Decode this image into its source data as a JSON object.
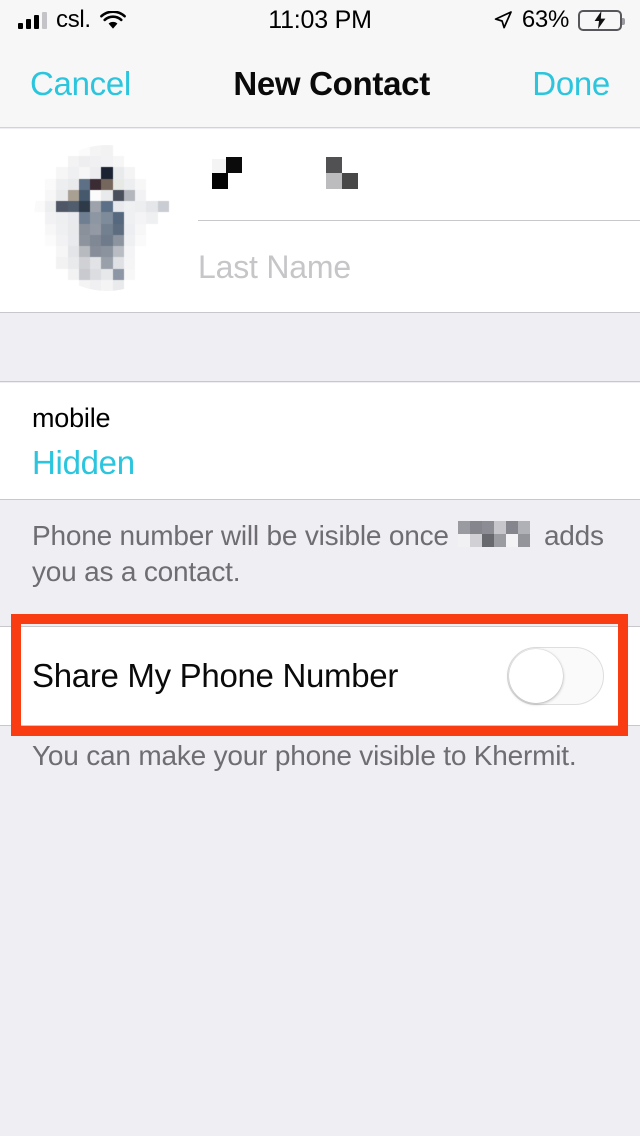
{
  "status_bar": {
    "carrier": "csl.",
    "time": "11:03 PM",
    "battery_percent": "63%",
    "battery_level": 63,
    "charging": true,
    "signal_bars_filled": 3,
    "signal_bars_total": 4,
    "icons": [
      "signal-bars-icon",
      "wifi-icon",
      "location-arrow-icon",
      "battery-charging-icon"
    ]
  },
  "nav_bar": {
    "cancel_label": "Cancel",
    "title": "New Contact",
    "done_label": "Done"
  },
  "name_section": {
    "avatar_alt": "contact-photo-pixelated",
    "first_name_value": "",
    "first_name_redacted": true,
    "last_name_placeholder": "Last Name",
    "last_name_value": ""
  },
  "phone_section": {
    "label": "mobile",
    "value": "Hidden"
  },
  "note_1": {
    "text_before": "Phone number will be visible once",
    "redacted_name": true,
    "text_after": "adds you as a contact."
  },
  "share_row": {
    "label": "Share My Phone Number",
    "toggle_state": "off",
    "toggle_on": false
  },
  "note_2": {
    "text": "You can make your phone visible to Khermit."
  },
  "colors": {
    "accent_cyan": "#2BC5DE",
    "annotation_red": "#F93C12",
    "battery_green": "#4CD964",
    "background": "#EFEEF3",
    "card": "#FFFFFF",
    "separator": "#C8C7CC",
    "secondary_text": "#6D6D72"
  }
}
